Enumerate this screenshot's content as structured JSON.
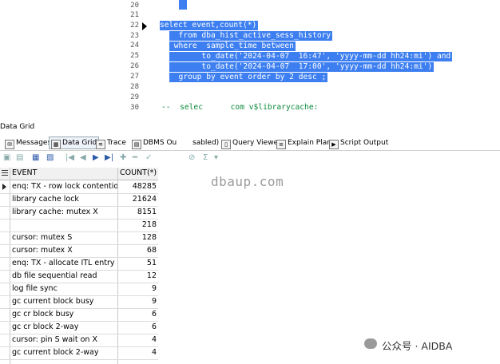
{
  "editor": {
    "lines": [
      {
        "num": "20",
        "text": "",
        "selected": true
      },
      {
        "num": "21",
        "text": "",
        "selected": false
      },
      {
        "num": "22",
        "text": "select event,count(*)",
        "selected": true
      },
      {
        "num": "23",
        "text": "  from dba_hist_active_sess_history",
        "selected": true
      },
      {
        "num": "24",
        "text": " where  sample_time between",
        "selected": true
      },
      {
        "num": "25",
        "text": "       to_date('2024-04-07  16:47', 'yyyy-mm-dd hh24:mi') and",
        "selected": true
      },
      {
        "num": "26",
        "text": "       to_date('2024-04-07  17:00', 'yyyy-mm-dd hh24:mi')",
        "selected": true
      },
      {
        "num": "27",
        "text": "  group by event order by 2 desc ;",
        "selected": true
      },
      {
        "num": "28",
        "text": "",
        "selected": false
      },
      {
        "num": "29",
        "text": "",
        "selected": false
      },
      {
        "num": "30",
        "text": "--  selec      com v$librarycache:",
        "selected": false
      }
    ]
  },
  "panel_title": "Data Grid",
  "tabs": [
    {
      "label": "Messages"
    },
    {
      "label": "Data Grid"
    },
    {
      "label": "Trace"
    },
    {
      "label": "DBMS Ou"
    },
    {
      "label": "sabled)"
    },
    {
      "label": "Query Viewer"
    },
    {
      "label": "Explain Plan"
    },
    {
      "label": "Script Output"
    }
  ],
  "grid": {
    "columns": [
      "EVENT",
      "COUNT(*)"
    ],
    "rows": [
      {
        "event": "enq: TX - row lock contention",
        "count": "48285"
      },
      {
        "event": "library cache lock",
        "count": "21624"
      },
      {
        "event": "library cache: mutex X",
        "count": "8151"
      },
      {
        "event": "",
        "count": "218"
      },
      {
        "event": "cursor: mutex S",
        "count": "128"
      },
      {
        "event": "cursor: mutex X",
        "count": "68"
      },
      {
        "event": "enq: TX - allocate ITL entry",
        "count": "51"
      },
      {
        "event": "db file sequential read",
        "count": "12"
      },
      {
        "event": "log file sync",
        "count": "9"
      },
      {
        "event": "gc current block busy",
        "count": "9"
      },
      {
        "event": "gc cr block busy",
        "count": "6"
      },
      {
        "event": "gc cr block 2-way",
        "count": "6"
      },
      {
        "event": "cursor: pin S wait on X",
        "count": "4"
      },
      {
        "event": "gc current block 2-way",
        "count": "4"
      }
    ]
  },
  "watermark": {
    "site": "dbaup.com",
    "brand": "公众号 · AIDBA"
  },
  "colors": {
    "selection": "#3d7ff0",
    "code_text": "#1a1a80",
    "comment": "#0a8a3a"
  }
}
